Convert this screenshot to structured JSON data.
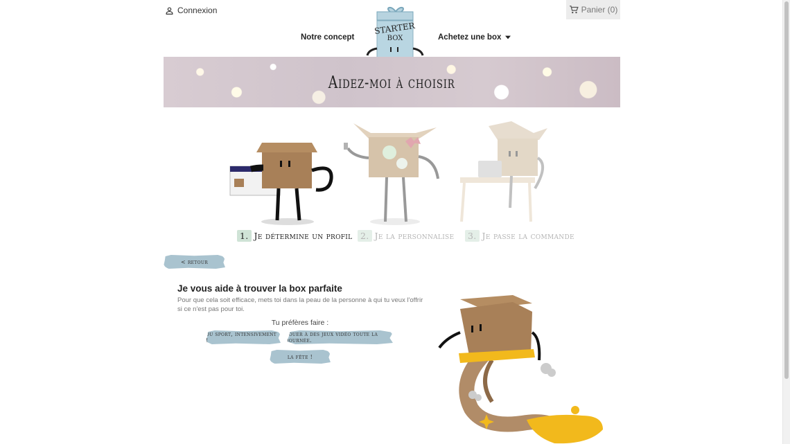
{
  "header": {
    "login_label": "Connexion",
    "cart_label": "Panier (0)",
    "nav_concept": "Notre concept",
    "nav_buy": "Achetez une box",
    "logo_line1": "STARTER",
    "logo_line2": "BOX"
  },
  "banner": {
    "title": "Aidez-moi à choisir"
  },
  "steps": [
    {
      "num": "1.",
      "label": "Je détermine un profil",
      "active": true
    },
    {
      "num": "2.",
      "label": "Je la personnalise",
      "active": false
    },
    {
      "num": "3.",
      "label": "Je passe la commande",
      "active": false
    }
  ],
  "back_button": "< retour",
  "quiz": {
    "title": "Je vous aide à trouver la box parfaite",
    "description": "Pour que cela soit efficace, mets toi dans la peau de la personne à qui tu veux l'offrir si ce n'est pas pour toi.",
    "question": "Tu préfères faire :",
    "options": [
      "du sport, intensivement !",
      "jouer à des jeux vidéo toute la journée.",
      "la fête !"
    ]
  },
  "colors": {
    "accent_blue": "#a9c3cf",
    "box_brown": "#a88058",
    "step_green": "#cfe3d6",
    "lamp_gold": "#f2b91c"
  },
  "icons": [
    "person-icon",
    "cart-icon",
    "caret-down-icon"
  ]
}
